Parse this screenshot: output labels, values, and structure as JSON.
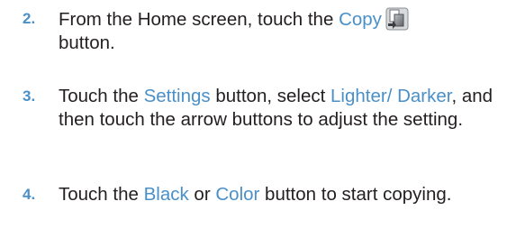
{
  "colors": {
    "accent": "#4a90c8",
    "text": "#231f20"
  },
  "steps": [
    {
      "number": "2.",
      "parts": [
        "From the Home screen, touch the ",
        "Copy",
        "button."
      ],
      "icon": "copy-icon"
    },
    {
      "number": "3.",
      "parts": [
        "Touch the ",
        "Settings",
        " button, select ",
        "Lighter/ Darker",
        ", and then touch the arrow buttons to adjust the setting."
      ]
    },
    {
      "number": "4.",
      "parts": [
        "Touch the ",
        "Black",
        " or ",
        "Color",
        " button to start copying."
      ]
    }
  ]
}
